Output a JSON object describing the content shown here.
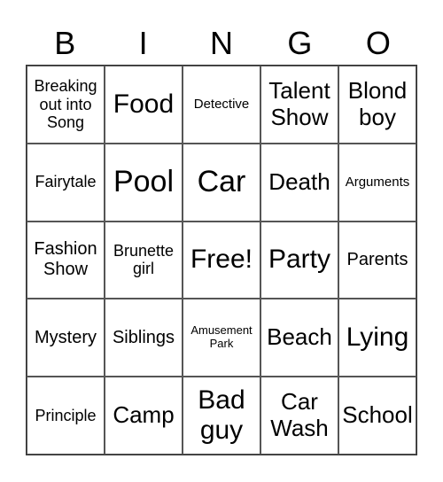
{
  "header": [
    "B",
    "I",
    "N",
    "G",
    "O"
  ],
  "cells": [
    [
      {
        "text": "Breaking out into Song",
        "size": "s3"
      },
      {
        "text": "Food",
        "size": "s6"
      },
      {
        "text": "Detective",
        "size": "s2"
      },
      {
        "text": "Talent Show",
        "size": "s5"
      },
      {
        "text": "Blond boy",
        "size": "s5"
      }
    ],
    [
      {
        "text": "Fairytale",
        "size": "s3"
      },
      {
        "text": "Pool",
        "size": "s7"
      },
      {
        "text": "Car",
        "size": "s7"
      },
      {
        "text": "Death",
        "size": "s5"
      },
      {
        "text": "Arguments",
        "size": "s2"
      }
    ],
    [
      {
        "text": "Fashion Show",
        "size": "s4"
      },
      {
        "text": "Brunette girl",
        "size": "s3"
      },
      {
        "text": "Free!",
        "size": "s6"
      },
      {
        "text": "Party",
        "size": "s6"
      },
      {
        "text": "Parents",
        "size": "s4"
      }
    ],
    [
      {
        "text": "Mystery",
        "size": "s4"
      },
      {
        "text": "Siblings",
        "size": "s4"
      },
      {
        "text": "Amusement Park",
        "size": "s1"
      },
      {
        "text": "Beach",
        "size": "s5"
      },
      {
        "text": "Lying",
        "size": "s6"
      }
    ],
    [
      {
        "text": "Principle",
        "size": "s3"
      },
      {
        "text": "Camp",
        "size": "s5"
      },
      {
        "text": "Bad guy",
        "size": "s6"
      },
      {
        "text": "Car Wash",
        "size": "s5"
      },
      {
        "text": "School",
        "size": "s5"
      }
    ]
  ]
}
